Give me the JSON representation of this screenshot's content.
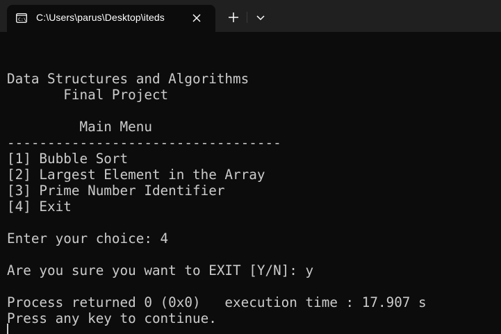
{
  "window": {
    "tab_title": "C:\\Users\\parus\\Desktop\\iteds",
    "tab_icon": "terminal-icon",
    "close_icon": "close-icon",
    "new_tab_icon": "plus-icon",
    "dropdown_icon": "chevron-down-icon"
  },
  "colors": {
    "background": "#0c0c0c",
    "tabbar": "#202020",
    "text": "#cccccc"
  },
  "terminal": {
    "lines": [
      "Data Structures and Algorithms",
      "       Final Project",
      "",
      "         Main Menu",
      "----------------------------------",
      "[1] Bubble Sort",
      "[2] Largest Element in the Array",
      "[3] Prime Number Identifier",
      "[4] Exit",
      "",
      "Enter your choice: 4",
      "",
      "Are you sure you want to EXIT [Y/N]: y",
      "",
      "Process returned 0 (0x0)   execution time : 17.907 s",
      "Press any key to continue."
    ]
  }
}
